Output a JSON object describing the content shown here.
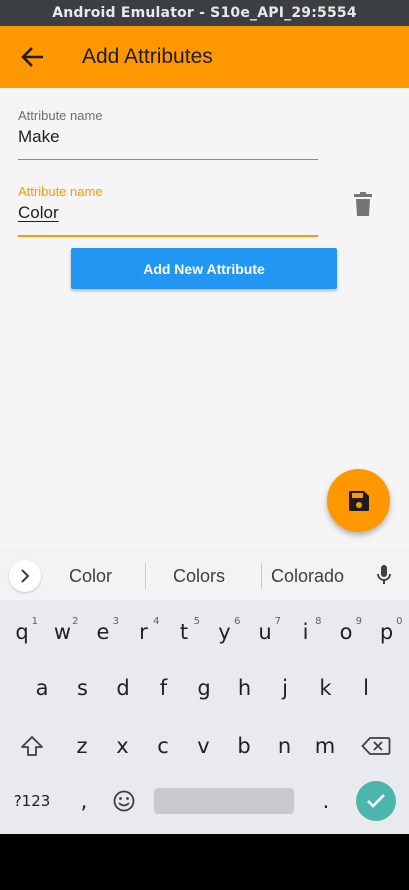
{
  "window": {
    "title": "Android Emulator - S10e_API_29:5554"
  },
  "appbar": {
    "title": "Add Attributes",
    "back_icon": "arrow-back-icon",
    "color": "#ff9800"
  },
  "fields": [
    {
      "label": "Attribute name",
      "value": "Make"
    },
    {
      "label": "Attribute name",
      "value": "Color"
    }
  ],
  "buttons": {
    "add_new": "Add New Attribute"
  },
  "fab": {
    "icon": "save-icon"
  },
  "keyboard": {
    "suggestions": [
      "Color",
      "Colors",
      "Colorado"
    ],
    "row1": [
      {
        "k": "q",
        "h": "1"
      },
      {
        "k": "w",
        "h": "2"
      },
      {
        "k": "e",
        "h": "3"
      },
      {
        "k": "r",
        "h": "4"
      },
      {
        "k": "t",
        "h": "5"
      },
      {
        "k": "y",
        "h": "6"
      },
      {
        "k": "u",
        "h": "7"
      },
      {
        "k": "i",
        "h": "8"
      },
      {
        "k": "o",
        "h": "9"
      },
      {
        "k": "p",
        "h": "0"
      }
    ],
    "row2": [
      "a",
      "s",
      "d",
      "f",
      "g",
      "h",
      "j",
      "k",
      "l"
    ],
    "row3": [
      "z",
      "x",
      "c",
      "v",
      "b",
      "n",
      "m"
    ],
    "symbols_key": "?123",
    "comma": ",",
    "period": "."
  }
}
